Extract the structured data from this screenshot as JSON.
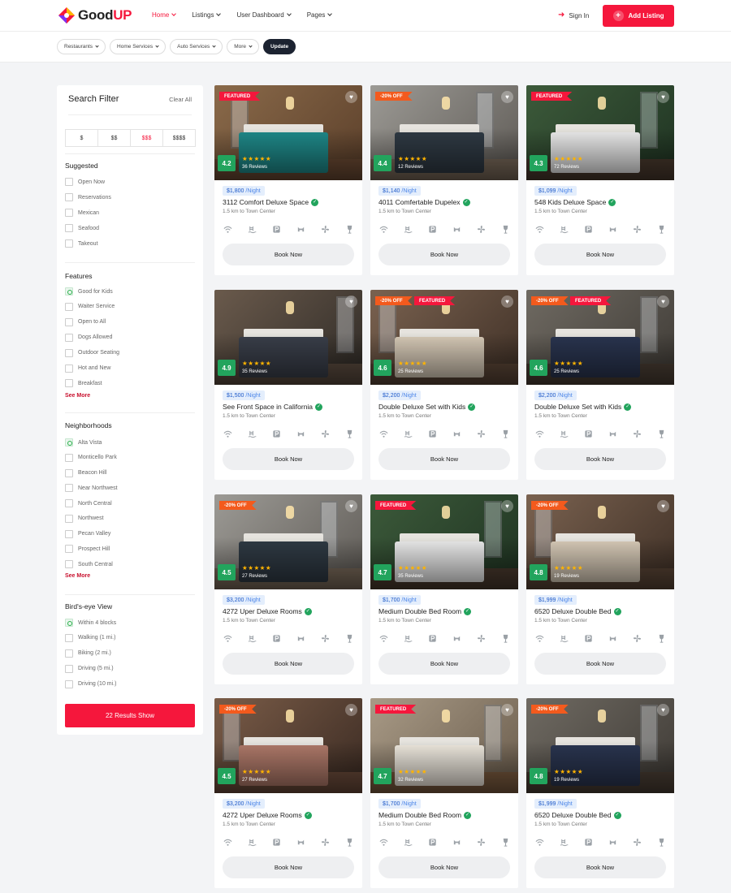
{
  "header": {
    "logo": {
      "part1": "Good",
      "part2": "UP"
    },
    "nav": [
      {
        "label": "Home",
        "active": true
      },
      {
        "label": "Listings",
        "active": false
      },
      {
        "label": "User Dashboard",
        "active": false
      },
      {
        "label": "Pages",
        "active": false
      }
    ],
    "sign_in": "Sign In",
    "add_listing": "Add Listing",
    "accent_color": "#f5173c"
  },
  "filter_bar": {
    "pills": [
      "Restaurants",
      "Home Services",
      "Auto Services",
      "More"
    ],
    "update": "Update"
  },
  "sidebar": {
    "title": "Search Filter",
    "clear": "Clear All",
    "prices": [
      {
        "label": "$",
        "active": false
      },
      {
        "label": "$$",
        "active": false
      },
      {
        "label": "$$$",
        "active": true
      },
      {
        "label": "$$$$",
        "active": false
      }
    ],
    "suggested": {
      "title": "Suggested",
      "items": [
        {
          "label": "Open Now",
          "checked": false
        },
        {
          "label": "Reservations",
          "checked": false
        },
        {
          "label": "Mexican",
          "checked": false
        },
        {
          "label": "Seafood",
          "checked": false
        },
        {
          "label": "Takeout",
          "checked": false
        }
      ]
    },
    "features": {
      "title": "Features",
      "items": [
        {
          "label": "Good for Kids",
          "checked": true
        },
        {
          "label": "Waiter Service",
          "checked": false
        },
        {
          "label": "Open to All",
          "checked": false
        },
        {
          "label": "Dogs Allowed",
          "checked": false
        },
        {
          "label": "Outdoor Seating",
          "checked": false
        },
        {
          "label": "Hot and New",
          "checked": false
        },
        {
          "label": "Breakfast",
          "checked": false
        }
      ],
      "see_more": "See More"
    },
    "neighborhoods": {
      "title": "Neighborhoods",
      "items": [
        {
          "label": "Alta Vista",
          "checked": true
        },
        {
          "label": "Monticello Park",
          "checked": false
        },
        {
          "label": "Beacon Hill",
          "checked": false
        },
        {
          "label": "Near Northwest",
          "checked": false
        },
        {
          "label": "North Central",
          "checked": false
        },
        {
          "label": "Northwest",
          "checked": false
        },
        {
          "label": "Pecan Valley",
          "checked": false
        },
        {
          "label": "Prospect Hill",
          "checked": false
        },
        {
          "label": "South Central",
          "checked": false
        }
      ],
      "see_more": "See More"
    },
    "birds_eye": {
      "title": "Bird's-eye View",
      "items": [
        {
          "label": "Within 4 blocks",
          "checked": true
        },
        {
          "label": "Walking (1 mi.)",
          "checked": false
        },
        {
          "label": "Biking (2 mi.)",
          "checked": false
        },
        {
          "label": "Driving (5 mi.)",
          "checked": false
        },
        {
          "label": "Driving (10 mi.)",
          "checked": false
        }
      ]
    },
    "results_button": "22 Results Show"
  },
  "cards": [
    {
      "badges": [
        "FEATURED"
      ],
      "rating": "4.2",
      "stars": 5,
      "reviews": "36 Reviews",
      "price": "$1,800",
      "per": "/Night",
      "title": "3112 Comfort Deluxe Space",
      "distance": "1.5 km to Town Center",
      "book": "Book Now",
      "palette": "teal"
    },
    {
      "badges": [
        "-20% OFF"
      ],
      "rating": "4.4",
      "stars": 5,
      "reviews": "12 Reviews",
      "price": "$1,140",
      "per": "/Night",
      "title": "4011 Comfertable Dupelex",
      "distance": "1.5 km to Town Center",
      "book": "Book Now",
      "palette": "grey"
    },
    {
      "badges": [
        "FEATURED"
      ],
      "rating": "4.3",
      "stars": 5,
      "reviews": "72 Reviews",
      "price": "$1,099",
      "per": "/Night",
      "title": "548 Kids Deluxe Space",
      "distance": "1.5 km to Town Center",
      "book": "Book Now",
      "palette": "green"
    },
    {
      "badges": [],
      "rating": "4.9",
      "stars": 5,
      "reviews": "35 Reviews",
      "price": "$1,500",
      "per": "/Night",
      "title": "See Front Space in California",
      "distance": "1.5 km to Town Center",
      "book": "Book Now",
      "palette": "loft"
    },
    {
      "badges": [
        "-20% OFF",
        "FEATURED"
      ],
      "rating": "4.6",
      "stars": 5,
      "reviews": "25 Reviews",
      "price": "$2,200",
      "per": "/Night",
      "title": "Double Deluxe Set with Kids",
      "distance": "1.5 km to Town Center",
      "book": "Book Now",
      "palette": "warm"
    },
    {
      "badges": [
        "-20% OFF",
        "FEATURED"
      ],
      "rating": "4.6",
      "stars": 5,
      "reviews": "25 Reviews",
      "price": "$2,200",
      "per": "/Night",
      "title": "Double Deluxe Set with Kids",
      "distance": "1.5 km to Town Center",
      "book": "Book Now",
      "palette": "navy"
    },
    {
      "badges": [
        "-20% OFF"
      ],
      "rating": "4.5",
      "stars": 5,
      "reviews": "27 Reviews",
      "price": "$3,200",
      "per": "/Night",
      "title": "4272 Uper Deluxe Rooms",
      "distance": "1.5 km to Town Center",
      "book": "Book Now",
      "palette": "grey"
    },
    {
      "badges": [
        "FEATURED"
      ],
      "rating": "4.7",
      "stars": 5,
      "reviews": "35 Reviews",
      "price": "$1,700",
      "per": "/Night",
      "title": "Medium Double Bed Room",
      "distance": "1.5 km to Town Center",
      "book": "Book Now",
      "palette": "green"
    },
    {
      "badges": [
        "-20% OFF"
      ],
      "rating": "4.8",
      "stars": 5,
      "reviews": "19 Reviews",
      "price": "$1,999",
      "per": "/Night",
      "title": "6520 Deluxe Double Bed",
      "distance": "1.5 km to Town Center",
      "book": "Book Now",
      "palette": "warm"
    },
    {
      "badges": [
        "-20% OFF"
      ],
      "rating": "4.5",
      "stars": 5,
      "reviews": "27 Reviews",
      "price": "$3,200",
      "per": "/Night",
      "title": "4272 Uper Deluxe Rooms",
      "distance": "1.5 km to Town Center",
      "book": "Book Now",
      "palette": "cafe"
    },
    {
      "badges": [
        "FEATURED"
      ],
      "rating": "4.7",
      "stars": 5,
      "reviews": "32 Reviews",
      "price": "$1,700",
      "per": "/Night",
      "title": "Medium Double Bed Room",
      "distance": "1.5 km to Town Center",
      "book": "Book Now",
      "palette": "cream"
    },
    {
      "badges": [
        "-20% OFF"
      ],
      "rating": "4.8",
      "stars": 5,
      "reviews": "19 Reviews",
      "price": "$1,999",
      "per": "/Night",
      "title": "6520 Deluxe Double Bed",
      "distance": "1.5 km to Town Center",
      "book": "Book Now",
      "palette": "navy"
    }
  ],
  "amenity_icons": [
    "wifi-icon",
    "pool-icon",
    "parking-icon",
    "pet-icon",
    "fan-icon",
    "bar-icon"
  ],
  "colors": {
    "accent": "#f5173c",
    "rating_green": "#22a45d",
    "off_tag": "#f35a1d",
    "star": "#ffb400",
    "price_text": "#1c58c8"
  }
}
